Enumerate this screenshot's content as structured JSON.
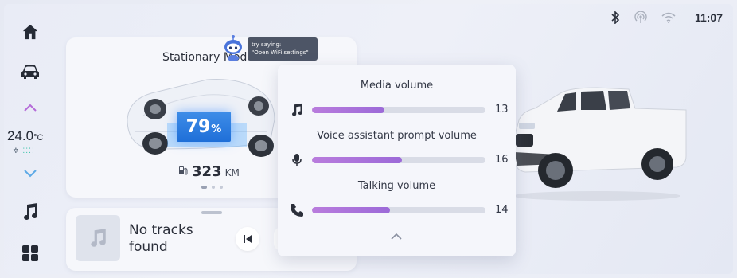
{
  "status_bar": {
    "time": "11:07"
  },
  "climate": {
    "temperature": "24.0",
    "unit": "°C"
  },
  "assistant": {
    "hint_line1": "try saying:",
    "hint_line2": "\"Open WiFi settings\""
  },
  "vehicle_card": {
    "title": "Stationary Mod",
    "battery_percent": "79",
    "battery_sign": "%",
    "range_value": "323",
    "range_unit": "KM",
    "page_count": 3,
    "active_page": 1
  },
  "media": {
    "track_title_line1": "No tracks",
    "track_title_line2": "found"
  },
  "volume_panel": {
    "max": 31,
    "items": [
      {
        "label": "Media volume",
        "value": 13,
        "display": "13",
        "icon": "music-note-icon"
      },
      {
        "label": "Voice assistant prompt volume",
        "value": 16,
        "display": "16",
        "icon": "microphone-icon"
      },
      {
        "label": "Talking volume",
        "value": 14,
        "display": "14",
        "icon": "phone-icon"
      }
    ]
  },
  "colors": {
    "accent_purple": "#a874dc",
    "battery_blue": "#2a7be0",
    "fan_teal": "#38c3a8"
  }
}
